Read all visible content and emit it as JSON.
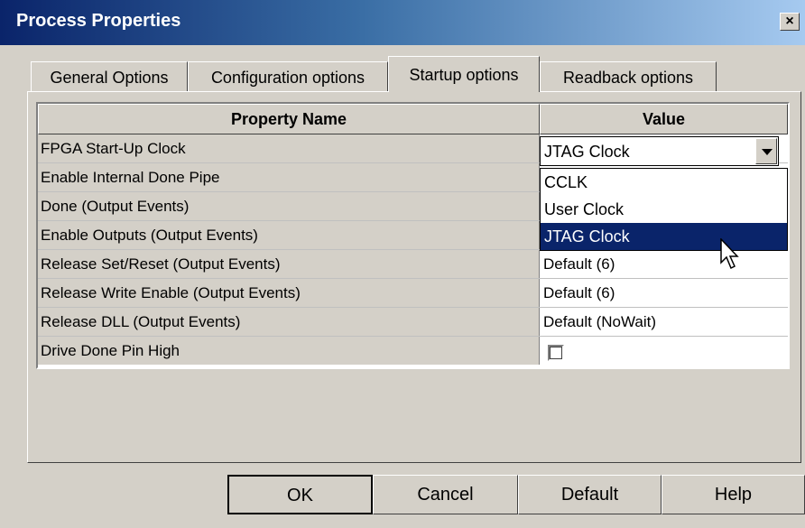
{
  "window": {
    "title": "Process Properties",
    "close_label": "×"
  },
  "tabs": [
    {
      "label": "General Options",
      "active": false
    },
    {
      "label": "Configuration options",
      "active": false
    },
    {
      "label": "Startup options",
      "active": true
    },
    {
      "label": "Readback options",
      "active": false
    }
  ],
  "table": {
    "headers": {
      "name": "Property Name",
      "value": "Value"
    },
    "rows": [
      {
        "name": "FPGA Start-Up Clock",
        "value": "JTAG Clock"
      },
      {
        "name": "Enable Internal Done Pipe",
        "value": ""
      },
      {
        "name": "Done (Output Events)",
        "value": ""
      },
      {
        "name": "Enable Outputs (Output Events)",
        "value": ""
      },
      {
        "name": "Release Set/Reset (Output Events)",
        "value": "Default (6)"
      },
      {
        "name": "Release Write Enable (Output Events)",
        "value": "Default (6)"
      },
      {
        "name": "Release DLL (Output Events)",
        "value": "Default (NoWait)"
      },
      {
        "name": "Drive Done Pin High",
        "value": "",
        "checked": false
      }
    ]
  },
  "dropdown": {
    "options": [
      "CCLK",
      "User Clock",
      "JTAG Clock"
    ],
    "selected": "JTAG Clock"
  },
  "buttons": {
    "ok": "OK",
    "cancel": "Cancel",
    "default": "Default",
    "help": "Help"
  },
  "colors": {
    "title_start": "#0a246a",
    "title_end": "#a6caf0",
    "selection": "#0a246a",
    "face": "#d4d0c8"
  },
  "icons": {
    "close": "close-icon",
    "combo": "chevron-down-icon",
    "cursor": "mouse-pointer-icon"
  }
}
